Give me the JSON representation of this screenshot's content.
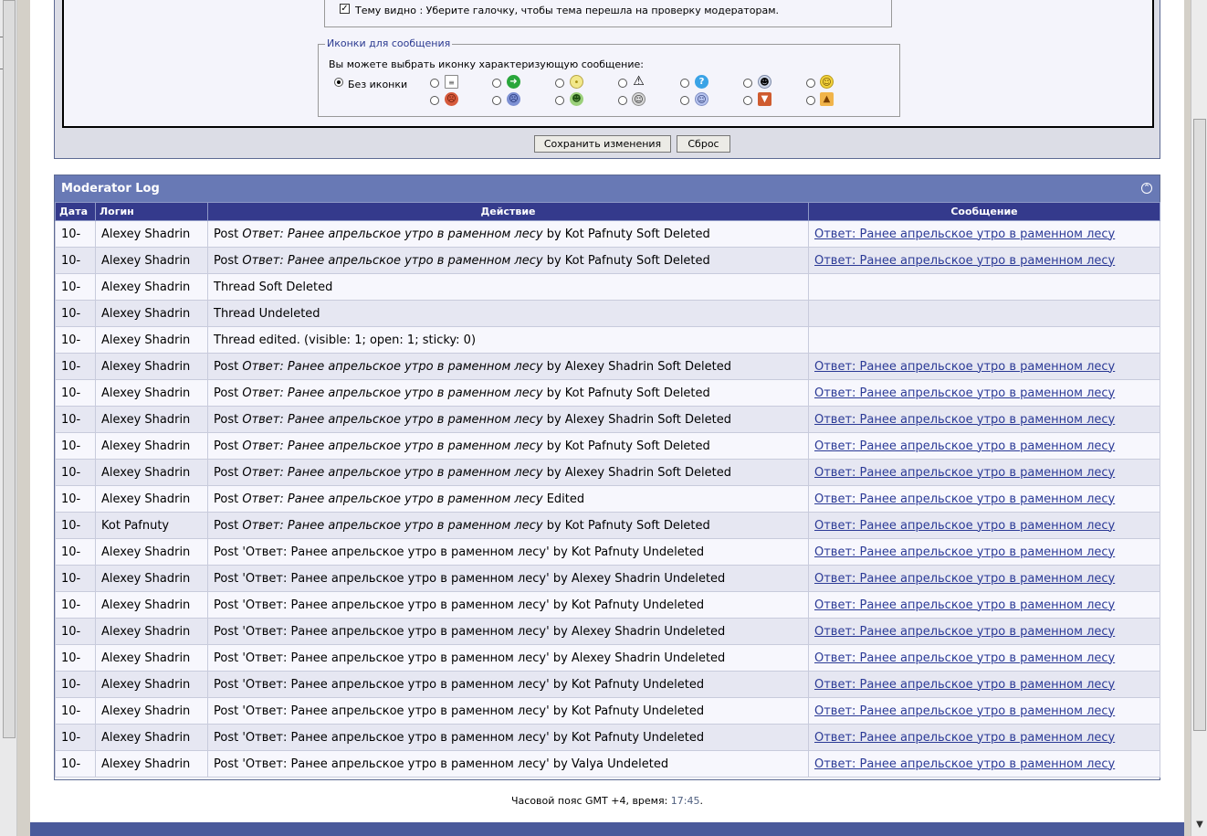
{
  "form": {
    "visible_text": "Тему видно : Уберите галочку, чтобы тема перешла на проверку модераторам.",
    "icons_legend": "Иконки для сообщения",
    "icons_desc": "Вы можете выбрать иконку характеризующую сообщение:",
    "no_icon_label": "Без иконки",
    "icons": [
      "page-icon",
      "arrow-right-icon",
      "lightbulb-icon",
      "warning-icon",
      "question-icon",
      "cool-icon",
      "smile-icon",
      "angry-icon",
      "sad-icon",
      "grin-icon",
      "laugh-icon",
      "wink-icon",
      "thumbs-down-icon",
      "thumbs-up-icon"
    ],
    "save_label": "Сохранить изменения",
    "reset_label": "Сброс"
  },
  "log": {
    "title": "Moderator Log",
    "columns": [
      "Дата",
      "Логин",
      "Действие",
      "Сообщение"
    ],
    "rows": [
      {
        "date": "10-",
        "login": "Alexey Shadrin",
        "pre": "Post ",
        "italic": "Ответ: Ранее апрельское утро в раменном лесу",
        "post": " by Kot Pafnuty Soft Deleted",
        "message": "Ответ: Ранее апрельское утро в раменном лесу"
      },
      {
        "date": "10-",
        "login": "Alexey Shadrin",
        "pre": "Post ",
        "italic": "Ответ: Ранее апрельское утро в раменном лесу",
        "post": " by Kot Pafnuty Soft Deleted",
        "message": "Ответ: Ранее апрельское утро в раменном лесу"
      },
      {
        "date": "10-",
        "login": "Alexey Shadrin",
        "pre": "Thread Soft Deleted",
        "italic": "",
        "post": "",
        "message": ""
      },
      {
        "date": "10-",
        "login": "Alexey Shadrin",
        "pre": "Thread Undeleted",
        "italic": "",
        "post": "",
        "message": ""
      },
      {
        "date": "10-",
        "login": "Alexey Shadrin",
        "pre": "Thread edited. (visible: 1; open: 1; sticky: 0)",
        "italic": "",
        "post": "",
        "message": ""
      },
      {
        "date": "10-",
        "login": "Alexey Shadrin",
        "pre": "Post ",
        "italic": "Ответ: Ранее апрельское утро в раменном лесу",
        "post": " by Alexey Shadrin Soft Deleted",
        "message": "Ответ: Ранее апрельское утро в раменном лесу"
      },
      {
        "date": "10-",
        "login": "Alexey Shadrin",
        "pre": "Post ",
        "italic": "Ответ: Ранее апрельское утро в раменном лесу",
        "post": " by Kot Pafnuty Soft Deleted",
        "message": "Ответ: Ранее апрельское утро в раменном лесу"
      },
      {
        "date": "10-",
        "login": "Alexey Shadrin",
        "pre": "Post ",
        "italic": "Ответ: Ранее апрельское утро в раменном лесу",
        "post": " by Alexey Shadrin Soft Deleted",
        "message": "Ответ: Ранее апрельское утро в раменном лесу"
      },
      {
        "date": "10-",
        "login": "Alexey Shadrin",
        "pre": "Post ",
        "italic": "Ответ: Ранее апрельское утро в раменном лесу",
        "post": " by Kot Pafnuty Soft Deleted",
        "message": "Ответ: Ранее апрельское утро в раменном лесу"
      },
      {
        "date": "10-",
        "login": "Alexey Shadrin",
        "pre": "Post ",
        "italic": "Ответ: Ранее апрельское утро в раменном лесу",
        "post": " by Alexey Shadrin Soft Deleted",
        "message": "Ответ: Ранее апрельское утро в раменном лесу"
      },
      {
        "date": "10-",
        "login": "Alexey Shadrin",
        "pre": "Post ",
        "italic": "Ответ: Ранее апрельское утро в раменном лесу",
        "post": " Edited",
        "message": "Ответ: Ранее апрельское утро в раменном лесу"
      },
      {
        "date": "10-",
        "login": "Kot Pafnuty",
        "pre": "Post ",
        "italic": "Ответ: Ранее апрельское утро в раменном лесу",
        "post": " by Kot Pafnuty Soft Deleted",
        "message": "Ответ: Ранее апрельское утро в раменном лесу"
      },
      {
        "date": "10-",
        "login": "Alexey Shadrin",
        "pre": "Post 'Ответ: Ранее апрельское утро в раменном лесу' by Kot Pafnuty Undeleted",
        "italic": "",
        "post": "",
        "message": "Ответ: Ранее апрельское утро в раменном лесу"
      },
      {
        "date": "10-",
        "login": "Alexey Shadrin",
        "pre": "Post 'Ответ: Ранее апрельское утро в раменном лесу' by Alexey Shadrin Undeleted",
        "italic": "",
        "post": "",
        "message": "Ответ: Ранее апрельское утро в раменном лесу"
      },
      {
        "date": "10-",
        "login": "Alexey Shadrin",
        "pre": "Post 'Ответ: Ранее апрельское утро в раменном лесу' by Kot Pafnuty Undeleted",
        "italic": "",
        "post": "",
        "message": "Ответ: Ранее апрельское утро в раменном лесу"
      },
      {
        "date": "10-",
        "login": "Alexey Shadrin",
        "pre": "Post 'Ответ: Ранее апрельское утро в раменном лесу' by Alexey Shadrin Undeleted",
        "italic": "",
        "post": "",
        "message": "Ответ: Ранее апрельское утро в раменном лесу"
      },
      {
        "date": "10-",
        "login": "Alexey Shadrin",
        "pre": "Post 'Ответ: Ранее апрельское утро в раменном лесу' by Alexey Shadrin Undeleted",
        "italic": "",
        "post": "",
        "message": "Ответ: Ранее апрельское утро в раменном лесу"
      },
      {
        "date": "10-",
        "login": "Alexey Shadrin",
        "pre": "Post 'Ответ: Ранее апрельское утро в раменном лесу' by Kot Pafnuty Undeleted",
        "italic": "",
        "post": "",
        "message": "Ответ: Ранее апрельское утро в раменном лесу"
      },
      {
        "date": "10-",
        "login": "Alexey Shadrin",
        "pre": "Post 'Ответ: Ранее апрельское утро в раменном лесу' by Kot Pafnuty Undeleted",
        "italic": "",
        "post": "",
        "message": "Ответ: Ранее апрельское утро в раменном лесу"
      },
      {
        "date": "10-",
        "login": "Alexey Shadrin",
        "pre": "Post 'Ответ: Ранее апрельское утро в раменном лесу' by Kot Pafnuty Undeleted",
        "italic": "",
        "post": "",
        "message": "Ответ: Ранее апрельское утро в раменном лесу"
      },
      {
        "date": "10-",
        "login": "Alexey Shadrin",
        "pre": "Post 'Ответ: Ранее апрельское утро в раменном лесу' by Valya Undeleted",
        "italic": "",
        "post": "",
        "message": "Ответ: Ранее апрельское утро в раменном лесу"
      }
    ]
  },
  "footer": {
    "timezone_text": "Часовой пояс GMT +4, время: ",
    "time": "17:45",
    "period": "."
  },
  "colors": {
    "header_bar": "#6879b5",
    "column_header": "#343a8c",
    "link": "#2b3a96"
  }
}
